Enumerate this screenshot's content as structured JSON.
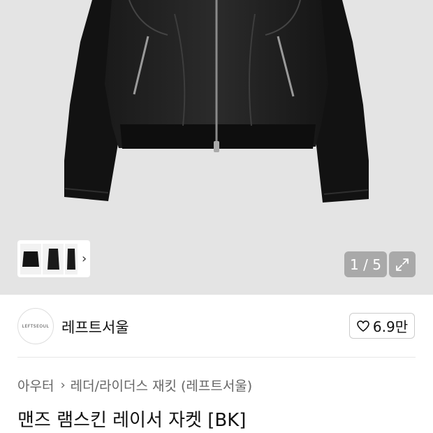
{
  "gallery": {
    "counter": "1 / 5",
    "thumb_more": "›"
  },
  "shop": {
    "logo_text": "LEFTSEOUL",
    "name": "레프트서울",
    "likes": "6.9만"
  },
  "breadcrumb": {
    "category": "아우터",
    "separator": "›",
    "subcategory": "레더/라이더스 재킷 (레프트서울)"
  },
  "product": {
    "title": "맨즈 램스킨 레이서 자켓 [BK]"
  }
}
